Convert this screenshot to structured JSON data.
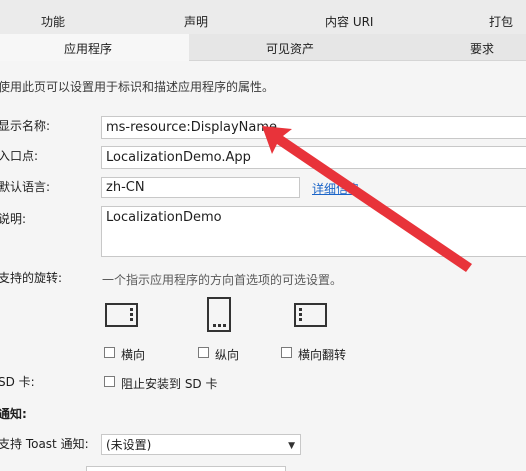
{
  "tabs_top": [
    "功能",
    "声明",
    "内容 URI",
    "打包"
  ],
  "tabs_bottom": [
    "应用程序",
    "可见资产",
    "要求"
  ],
  "intro": "使用此页可以设置用于标识和描述应用程序的属性。",
  "fields": {
    "display_name_label": "显示名称:",
    "display_name_value": "ms-resource:DisplayName",
    "entry_point_label": "入口点:",
    "entry_point_value": "LocalizationDemo.App",
    "language_label": "默认语言:",
    "language_value": "zh-CN",
    "language_link": "详细信息",
    "description_label": "说明:",
    "description_value": "LocalizationDemo"
  },
  "rotation": {
    "label": "支持的旋转:",
    "hint": "一个指示应用程序的方向首选项的可选设置。",
    "options": [
      "横向",
      "纵向",
      "横向翻转"
    ]
  },
  "sd": {
    "label": "SD 卡:",
    "option": "阻止安装到 SD 卡"
  },
  "notifications": {
    "heading": "通知:",
    "toast_label": "支持 Toast 通知:",
    "toast_value": "(未设置)"
  },
  "colors": {
    "arrow": "#e8333a",
    "link": "#1a64c8"
  }
}
